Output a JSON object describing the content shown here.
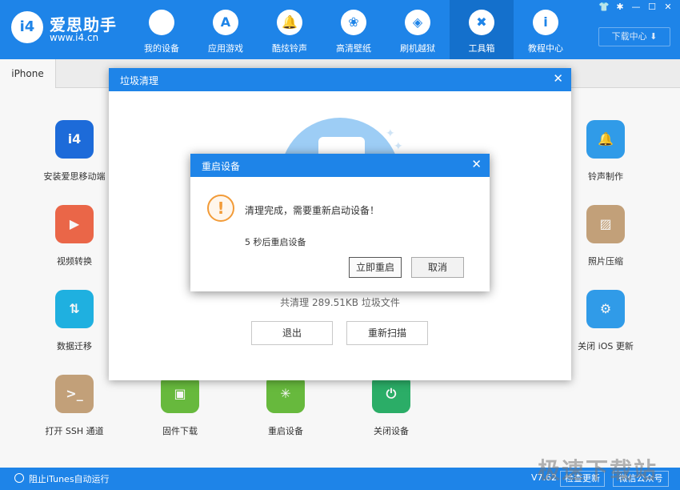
{
  "window": {
    "brand": "爱思助手",
    "site": "www.i4.cn",
    "logo_text": "i4",
    "controls": [
      "👕",
      "✱",
      "—",
      "☐",
      "✕"
    ],
    "download_center": "下载中心 ⬇"
  },
  "nav": [
    {
      "label": "我的设备",
      "icon": "apple-icon",
      "glyph": ""
    },
    {
      "label": "应用游戏",
      "icon": "app-store-icon",
      "glyph": "A"
    },
    {
      "label": "酷炫铃声",
      "icon": "bell-icon",
      "glyph": "🔔"
    },
    {
      "label": "高清壁纸",
      "icon": "flower-icon",
      "glyph": "❀"
    },
    {
      "label": "刷机越狱",
      "icon": "dropbox-icon",
      "glyph": "◈"
    },
    {
      "label": "工具箱",
      "icon": "tools-icon",
      "glyph": "✖",
      "active": true
    },
    {
      "label": "教程中心",
      "icon": "info-icon",
      "glyph": "i"
    }
  ],
  "tabs": [
    {
      "label": "iPhone"
    }
  ],
  "tools": {
    "install": {
      "label": "安装爱思移动端",
      "glyph": "i4",
      "color": "#1e6fe0"
    },
    "video": {
      "label": "视频转换",
      "glyph": "▶",
      "color": "#f26a4b"
    },
    "migrate": {
      "label": "数据迁移",
      "glyph": "⇅",
      "color": "#21b6e8"
    },
    "ssh": {
      "label": "打开 SSH 通道",
      "glyph": ">_",
      "color": "#c9a67d"
    },
    "firmware": {
      "label": "固件下载",
      "glyph": "▣",
      "color": "#6bbf3f"
    },
    "restart": {
      "label": "重启设备",
      "glyph": "✳",
      "color": "#6bbf3f"
    },
    "shutdown": {
      "label": "关闭设备",
      "glyph": "⏻",
      "color": "#2db36b"
    },
    "ringtone": {
      "label": "铃声制作",
      "glyph": "🔔",
      "color": "#32a0f0"
    },
    "photo": {
      "label": "照片压缩",
      "glyph": "▨",
      "color": "#c9a67d"
    },
    "ios": {
      "label": "关闭 iOS 更新",
      "glyph": "⚙",
      "color": "#32a0f0"
    }
  },
  "status": {
    "itunes": "阻止iTunes自动运行",
    "version": "V7.62",
    "check_update": "检查更新",
    "wechat": "微信公众号"
  },
  "cleanup_dialog": {
    "title": "垃圾清理",
    "close": "✕",
    "summary": "共清理 289.51KB 垃圾文件",
    "exit": "退出",
    "rescan": "重新扫描"
  },
  "restart_dialog": {
    "title": "重启设备",
    "close": "✕",
    "warn_glyph": "!",
    "message": "清理完成，需要重新启动设备！",
    "countdown": "5 秒后重启设备",
    "restart_now": "立即重启",
    "cancel": "取消"
  },
  "watermark": "极速下载站",
  "colors": {
    "primary": "#1e84e8",
    "active_nav": "#1470cc",
    "warning": "#f29b38"
  }
}
